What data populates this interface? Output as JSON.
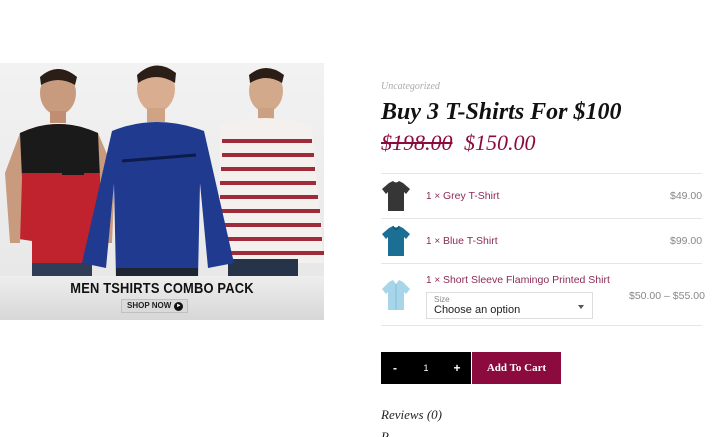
{
  "banner": {
    "title": "MEN TSHIRTS COMBO PACK",
    "shop_now": "SHOP NOW",
    "shop_now_icon": "arrow-right-icon"
  },
  "product": {
    "category": "Uncategorized",
    "title": "Buy 3 T-Shirts For $100",
    "price_regular": "$198.00",
    "price_sale": "$150.00",
    "accent_color": "#8c0b3e"
  },
  "bundle": {
    "items": [
      {
        "qty": "1 ×",
        "name": "Grey T-Shirt",
        "price": "$49.00",
        "thumb_color": "#3a3a3a"
      },
      {
        "qty": "1 ×",
        "name": "Blue T-Shirt",
        "price": "$99.00",
        "thumb_color": "#1b6f95"
      },
      {
        "qty": "1 ×",
        "name": "Short Sleeve Flamingo Printed Shirt",
        "price": "$50.00 – $55.00",
        "thumb_color": "#9fd0e6"
      }
    ],
    "size": {
      "label": "Size",
      "value": "Choose an option"
    }
  },
  "cart": {
    "minus": "-",
    "quantity": "1",
    "plus": "+",
    "add_to_cart": "Add To Cart"
  },
  "tabs": {
    "reviews": "Reviews (0)",
    "next_partial": "R"
  }
}
